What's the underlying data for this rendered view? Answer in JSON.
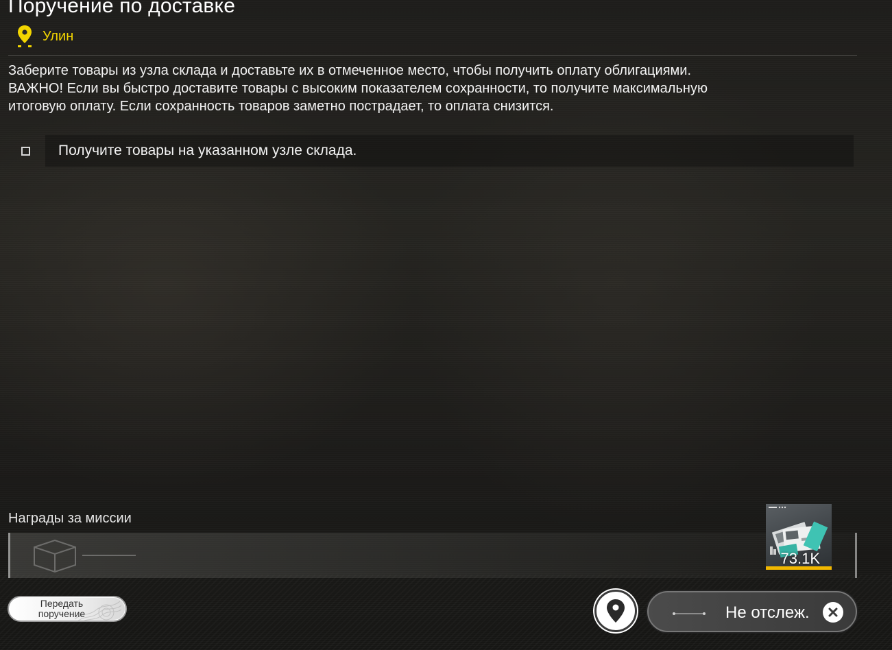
{
  "header": {
    "title": "Поручение по доставке",
    "location": "Улин"
  },
  "mission": {
    "description": "Заберите товары из узла склада и доставьте их в отмеченное место, чтобы получить оплату облигациями.\nВАЖНО! Если вы быстро доставите товары с высоким показателем сохранности, то получите максимальную\nитоговую оплату. Если сохранность товаров заметно пострадает, то оплата снизится.",
    "objectives": [
      {
        "text": "Получите товары на указанном узле склада.",
        "completed": false
      }
    ]
  },
  "rewards": {
    "title": "Награды за миссии",
    "items": [
      {
        "amount": "73.1K",
        "icon": "bonds-icon",
        "rarity_color": "#f2b800"
      }
    ]
  },
  "footer": {
    "handover_label": "Передать\nпоручение",
    "track_label": "Не отслеж.",
    "map_icon": "map-pin-icon",
    "close_icon": "close-icon"
  },
  "colors": {
    "accent": "#f2d500",
    "reward_bar": "#f2b800"
  }
}
